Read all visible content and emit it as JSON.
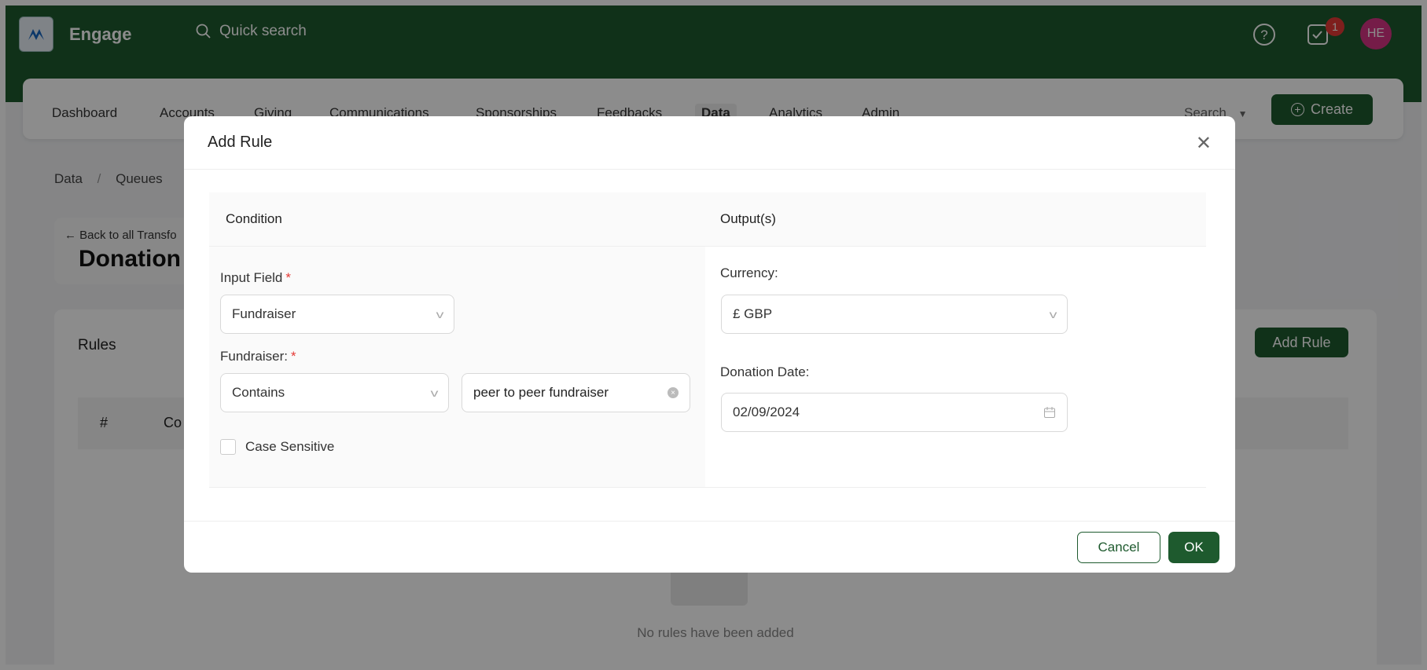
{
  "header": {
    "app_name": "Engage",
    "search_placeholder": "Quick search",
    "notification_count": "1",
    "avatar_initials": "HE"
  },
  "nav": {
    "items": [
      "Dashboard",
      "Accounts",
      "Giving",
      "Communications",
      "Sponsorships",
      "Feedbacks",
      "Data",
      "Analytics",
      "Admin"
    ],
    "active": "Data",
    "search_label": "Search",
    "create_label": "Create"
  },
  "page": {
    "breadcrumb": [
      "Data",
      "Queues"
    ],
    "back_link": "Back to all Transfo",
    "title": "Donation",
    "rules_title": "Rules",
    "add_rule_label": "Add Rule",
    "table_headers": [
      "#",
      "Co"
    ],
    "empty_text": "No rules have been added"
  },
  "modal": {
    "title": "Add Rule",
    "condition_header": "Condition",
    "output_header": "Output(s)",
    "input_field_label": "Input Field",
    "input_field_value": "Fundraiser",
    "fundraiser_label": "Fundraiser:",
    "operator_value": "Contains",
    "match_value": "peer to peer fundraiser",
    "case_sensitive_label": "Case Sensitive",
    "case_sensitive_checked": false,
    "currency_label": "Currency:",
    "currency_value": "£ GBP",
    "donation_date_label": "Donation Date:",
    "donation_date_value": "02/09/2024",
    "cancel_label": "Cancel",
    "ok_label": "OK"
  },
  "colors": {
    "brand_green": "#1e5a2e",
    "badge_red": "#e53935",
    "avatar_pink": "#d63384"
  }
}
